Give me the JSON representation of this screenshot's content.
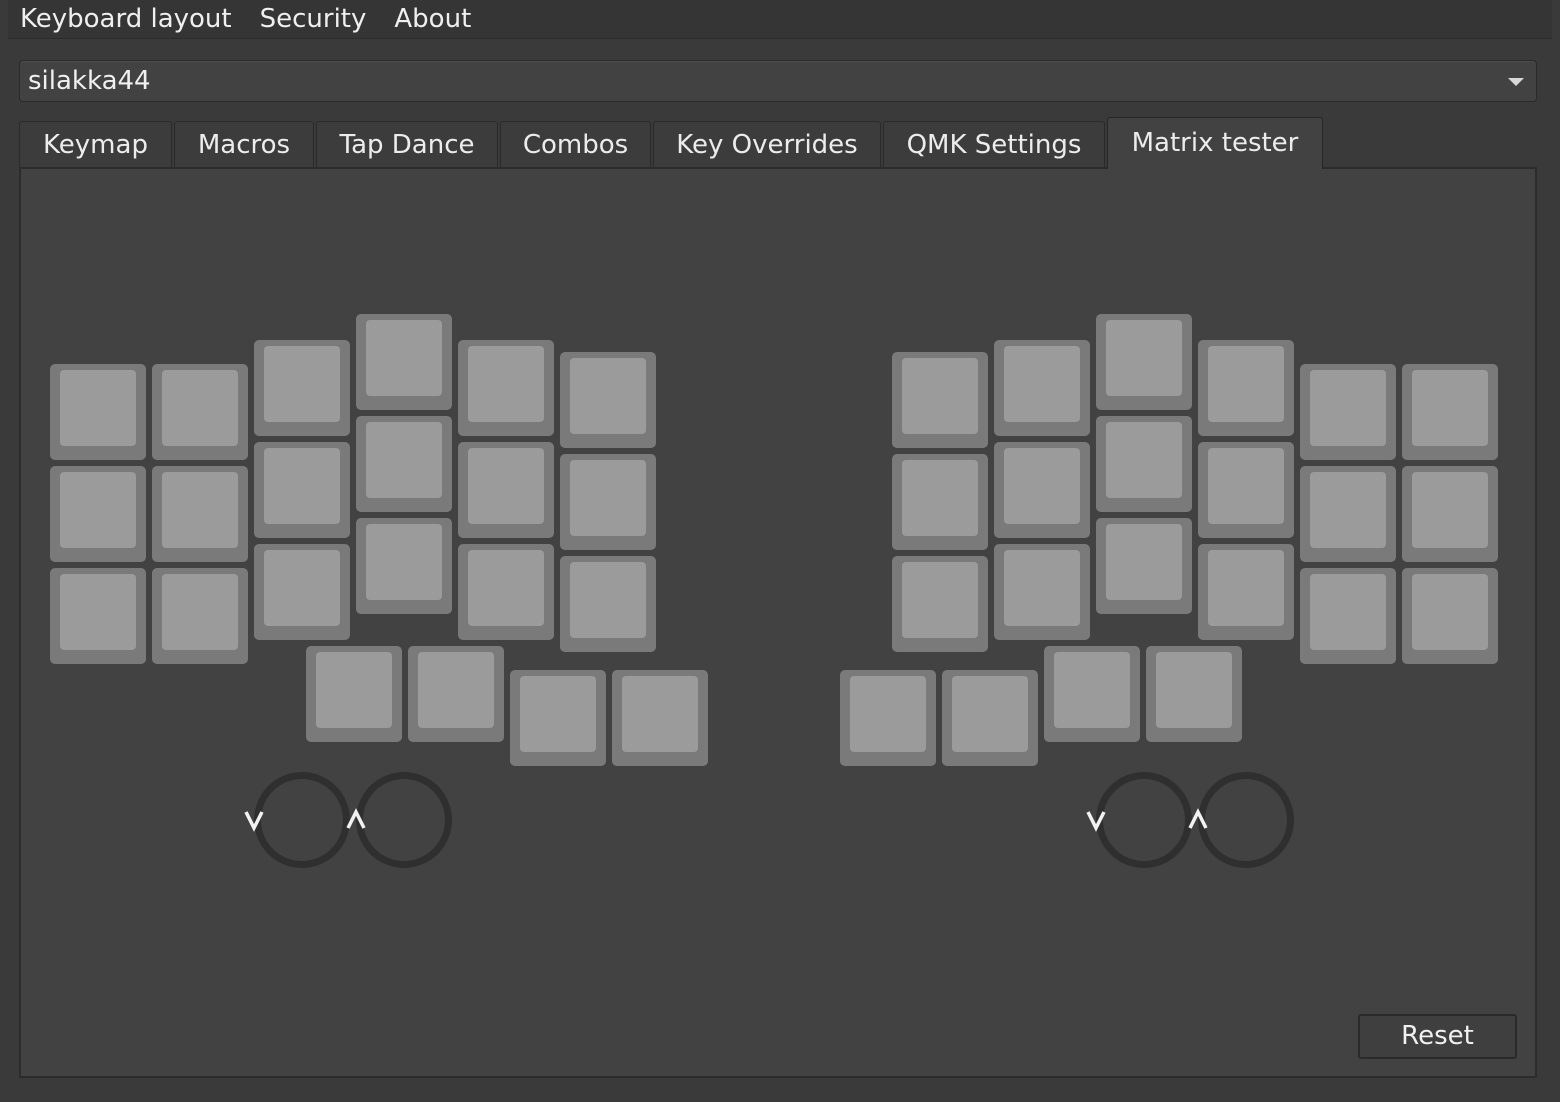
{
  "menubar": {
    "items": [
      "Keyboard layout",
      "Security",
      "About"
    ]
  },
  "keyboard_select": {
    "value": "silakka44"
  },
  "tabs": [
    {
      "label": "Keymap"
    },
    {
      "label": "Macros"
    },
    {
      "label": "Tap Dance"
    },
    {
      "label": "Combos"
    },
    {
      "label": "Key Overrides"
    },
    {
      "label": "QMK Settings"
    },
    {
      "label": "Matrix tester"
    }
  ],
  "active_tab": "Matrix tester",
  "encoders": {
    "ccw_symbol": "⌄",
    "cw_symbol": "⌃"
  },
  "reset_button": {
    "label": "Reset"
  },
  "colors": {
    "background": "#3a3a3a",
    "panel": "#424242",
    "key_border": "#7a7a7a",
    "key_face": "#9b9b9b",
    "encoder_ring": "#2f2f2f"
  }
}
